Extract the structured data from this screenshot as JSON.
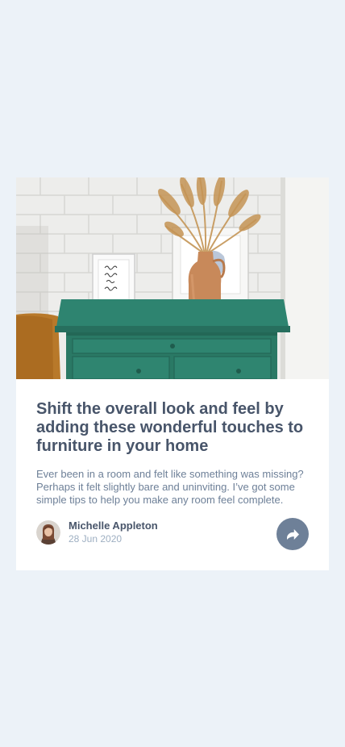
{
  "card": {
    "title": "Shift the overall look and feel by adding these wonderful touches to furniture in your home",
    "excerpt": "Ever been in a room and felt like something was missing? Perhaps it felt slightly bare and uninviting. I’ve got some simple tips to help you make any room feel complete.",
    "author": {
      "name": "Michelle Appleton",
      "date": "28 Jun 2020"
    },
    "share_icon": "share-icon"
  },
  "colors": {
    "background": "#ECF2F8",
    "title": "#48556A",
    "body_text": "#6E8098",
    "date_text": "#9EAFC2",
    "share_button": "#6E8098"
  }
}
